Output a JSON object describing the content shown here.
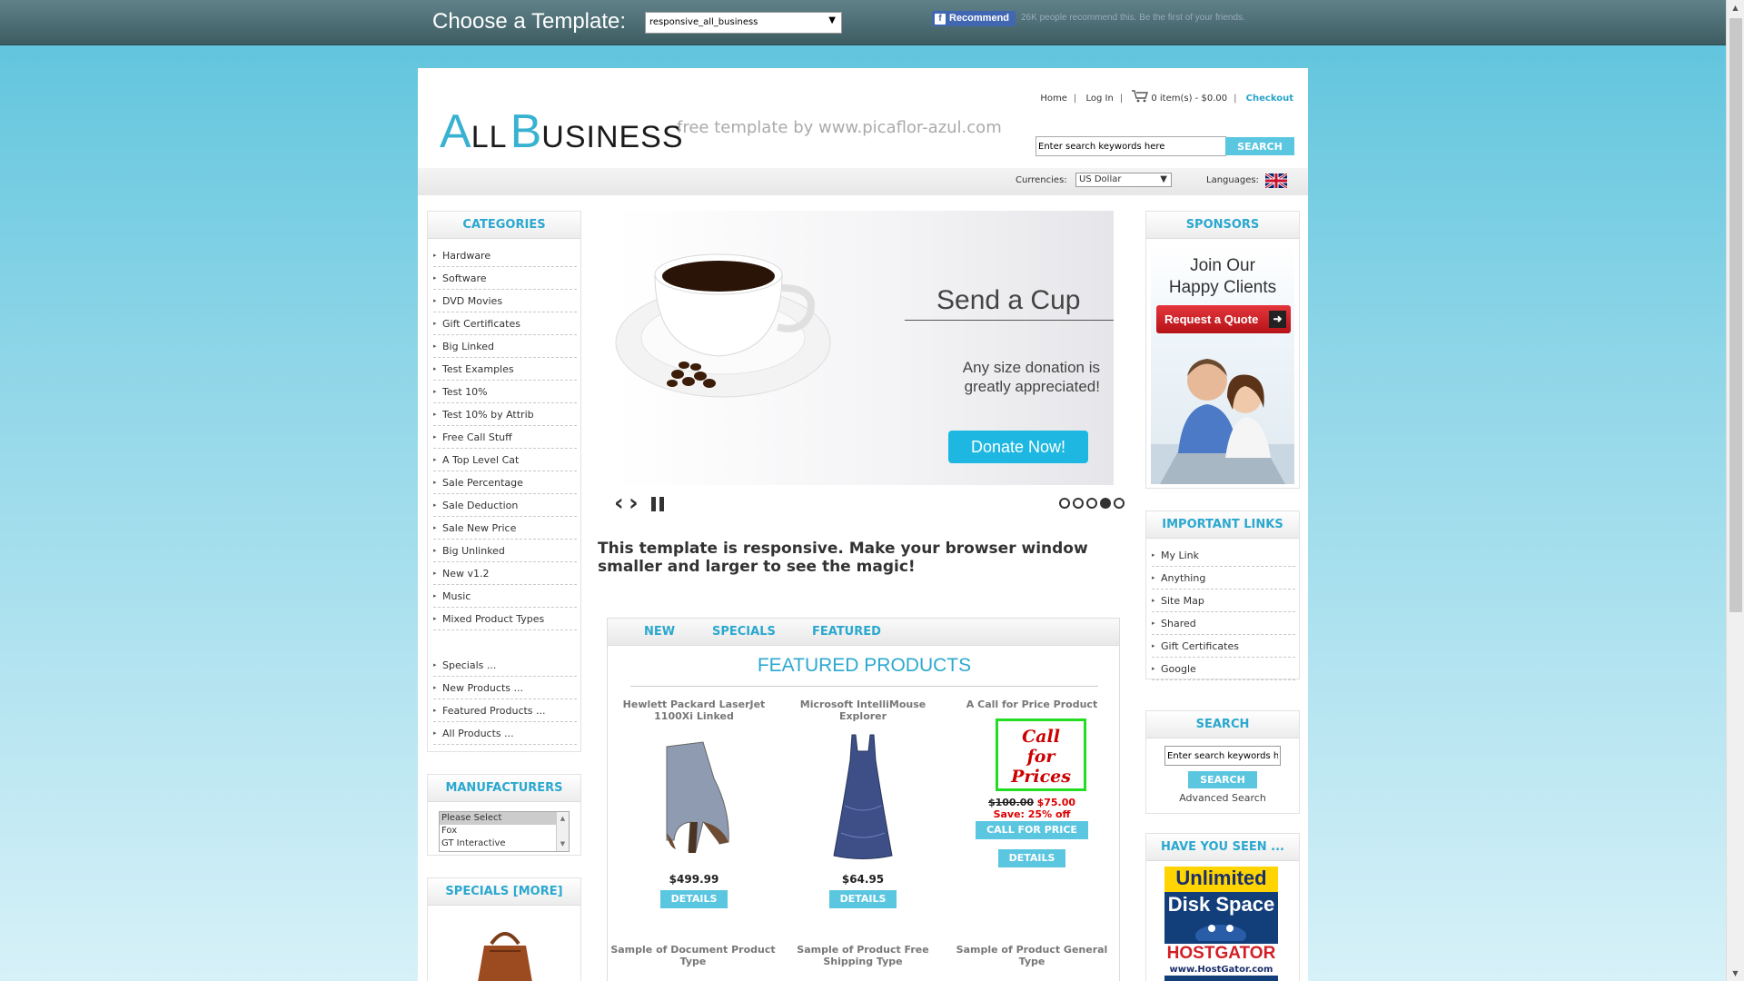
{
  "template_bar": {
    "label": "Choose a Template:",
    "selected_template": "responsive_all_business",
    "fb_button": "Recommend",
    "fb_text": "26K people recommend this. Be the first of your friends."
  },
  "header": {
    "logo_a": "A",
    "logo_ll": "LL",
    "logo_b": "B",
    "logo_usiness": "USINESS",
    "tagline": "free template by www.picaflor-azul.com",
    "links": {
      "home": "Home",
      "login": "Log In",
      "cart": "0 item(s) - $0.00",
      "checkout": "Checkout"
    },
    "search_placeholder": "Enter search keywords here",
    "search_button": "SEARCH",
    "currencies_label": "Currencies:",
    "currency_value": "US Dollar",
    "languages_label": "Languages:"
  },
  "categories": {
    "title": "CATEGORIES",
    "items": [
      "Hardware",
      "Software",
      "DVD Movies",
      "Gift Certificates",
      "Big Linked",
      "Test Examples",
      "Test 10%",
      "Test 10% by Attrib",
      "Free Call Stuff",
      "A Top Level Cat",
      "Sale Percentage",
      "Sale Deduction",
      "Sale New Price",
      "Big Unlinked",
      "New v1.2",
      "Music",
      "Mixed Product Types"
    ],
    "extra": [
      "Specials ...",
      "New Products ...",
      "Featured Products ...",
      "All Products ..."
    ]
  },
  "manufacturers": {
    "title": "MANUFACTURERS",
    "options": [
      "Please Select",
      "Fox",
      "GT Interactive"
    ]
  },
  "specials_box": {
    "title": "SPECIALS  [MORE]"
  },
  "slider": {
    "title": "Send a Cup",
    "text_line1": "Any size donation is",
    "text_line2": "greatly appreciated!",
    "button": "Donate Now!",
    "active_slide": 4,
    "slide_count": 5
  },
  "responsive_note": "This template is responsive. Make your browser window smaller and larger to see the magic!",
  "product_tabs": {
    "tabs": [
      "NEW",
      "SPECIALS",
      "FEATURED"
    ],
    "heading": "FEATURED PRODUCTS",
    "products": [
      {
        "name": "Hewlett Packard LaserJet 1100Xi Linked",
        "price": "$499.99",
        "button": "DETAILS"
      },
      {
        "name": "Microsoft IntelliMouse Explorer",
        "price": "$64.95",
        "button": "DETAILS"
      },
      {
        "name": "A Call for Price Product",
        "badge": "Call for Prices",
        "old_price": "$100.00",
        "new_price": "$75.00",
        "save": "Save: 25% off",
        "call_button": "CALL FOR PRICE",
        "button": "DETAILS"
      }
    ],
    "next_row": [
      "Sample of Document Product Type",
      "Sample of Product Free Shipping Type",
      "Sample of Product General Type"
    ]
  },
  "sponsors": {
    "title": "SPONSORS",
    "headline_1": "Join Our",
    "headline_2": "Happy Clients",
    "button": "Request a Quote"
  },
  "important_links": {
    "title": "IMPORTANT LINKS",
    "items": [
      "My Link",
      "Anything",
      "Site Map",
      "Shared",
      "Gift Certificates",
      "Google"
    ]
  },
  "right_search": {
    "title": "SEARCH",
    "placeholder": "Enter search keywords here",
    "button": "SEARCH",
    "advanced": "Advanced Search"
  },
  "have_you_seen": {
    "title": "HAVE YOU SEEN ...",
    "ad_line1": "Unlimited",
    "ad_line2": "Disk Space",
    "ad_brand": "HOSTGATOR",
    "ad_url": "www.HostGator.com"
  },
  "colors": {
    "accent": "#2ba8cf",
    "button": "#5bc6e0",
    "sale_red": "#dd0000"
  }
}
